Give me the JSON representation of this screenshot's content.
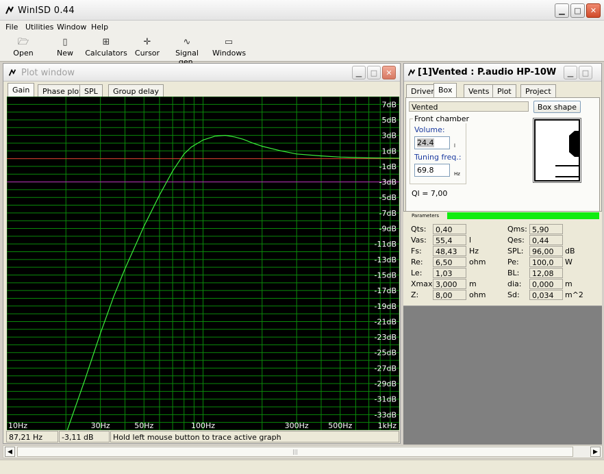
{
  "app": {
    "title": "WinISD 0.44"
  },
  "menu": [
    "File",
    "Utilities",
    "Window",
    "Help"
  ],
  "toolbar": [
    "Open",
    "New",
    "Calculators",
    "Cursor",
    "Signal gen.",
    "Windows"
  ],
  "plot_window": {
    "title": "Plot window",
    "tabs": [
      "Gain",
      "Phase plot",
      "SPL",
      "Group delay"
    ],
    "active_tab": "Gain",
    "status": {
      "freq": "87,21 Hz",
      "gain": "-3,11 dB",
      "hint": "Hold left mouse button to trace active graph"
    }
  },
  "chart_data": {
    "type": "line",
    "x_scale": "log",
    "xlim": [
      10,
      1000
    ],
    "ylim": [
      -35,
      8
    ],
    "x_ticks": [
      {
        "value": 10,
        "label": "10Hz"
      },
      {
        "value": 30,
        "label": "30Hz"
      },
      {
        "value": 50,
        "label": "50Hz"
      },
      {
        "value": 100,
        "label": "100Hz"
      },
      {
        "value": 300,
        "label": "300Hz"
      },
      {
        "value": 500,
        "label": "500Hz"
      },
      {
        "value": 1000,
        "label": "1kHz"
      }
    ],
    "y_ticks": [
      {
        "value": 7,
        "label": "7dB"
      },
      {
        "value": 5,
        "label": "5dB"
      },
      {
        "value": 3,
        "label": "3dB"
      },
      {
        "value": 1,
        "label": "1dB"
      },
      {
        "value": -1,
        "label": "-1dB"
      },
      {
        "value": -3,
        "label": "-3dB"
      },
      {
        "value": -5,
        "label": "-5dB"
      },
      {
        "value": -7,
        "label": "-7dB"
      },
      {
        "value": -9,
        "label": "-9dB"
      },
      {
        "value": -11,
        "label": "-11dB"
      },
      {
        "value": -13,
        "label": "-13dB"
      },
      {
        "value": -15,
        "label": "-15dB"
      },
      {
        "value": -17,
        "label": "-17dB"
      },
      {
        "value": -19,
        "label": "-19dB"
      },
      {
        "value": -21,
        "label": "-21dB"
      },
      {
        "value": -23,
        "label": "-23dB"
      },
      {
        "value": -25,
        "label": "-25dB"
      },
      {
        "value": -27,
        "label": "-27dB"
      },
      {
        "value": -29,
        "label": "-29dB"
      },
      {
        "value": -31,
        "label": "-31dB"
      },
      {
        "value": -33,
        "label": "-33dB"
      }
    ],
    "reference_lines": [
      {
        "y": 0,
        "color": "#e03030"
      },
      {
        "y": -3,
        "color": "#c020c0"
      }
    ],
    "series": [
      {
        "color": "#3cf03c",
        "x": [
          20,
          25,
          30,
          35,
          40,
          50,
          60,
          70,
          80,
          87.21,
          100,
          115,
          130,
          145,
          160,
          180,
          200,
          250,
          300,
          400,
          500,
          700,
          1000
        ],
        "y": [
          -35.5,
          -28.5,
          -22.5,
          -17.8,
          -14.2,
          -8.7,
          -4.7,
          -1.6,
          0.6,
          1.5,
          2.4,
          2.9,
          3.0,
          2.8,
          2.5,
          2.0,
          1.6,
          1.0,
          0.6,
          0.35,
          0.2,
          0.1,
          0.05
        ]
      }
    ],
    "grid": true
  },
  "box_window": {
    "title": "[1]Vented : P.audio HP-10W",
    "tabs": [
      "Driver",
      "Box",
      "Vents",
      "Plot",
      "Project"
    ],
    "active_tab": "Box",
    "box_type": "Vented",
    "box_shape_button": "Box shape",
    "front_chamber_label": "Front chamber",
    "volume_label": "Volume:",
    "volume_value": "24.4",
    "volume_unit": "l",
    "tuning_label": "Tuning freq.:",
    "tuning_value": "69.8",
    "tuning_unit": "Hz",
    "ql": "Ql = 7,00",
    "parameters_label": "Parameters",
    "params_left": [
      {
        "name": "Qts:",
        "value": "0,40",
        "unit": ""
      },
      {
        "name": "Vas:",
        "value": "55,4",
        "unit": "l"
      },
      {
        "name": "Fs:",
        "value": "48,43",
        "unit": "Hz"
      },
      {
        "name": "Re:",
        "value": "6,50",
        "unit": "ohm"
      },
      {
        "name": "Le:",
        "value": "1,03",
        "unit": ""
      },
      {
        "name": "Xmax:",
        "value": "3,000",
        "unit": "m"
      },
      {
        "name": "Z:",
        "value": "8,00",
        "unit": "ohm"
      }
    ],
    "params_right": [
      {
        "name": "Qms:",
        "value": "5,90",
        "unit": ""
      },
      {
        "name": "Qes:",
        "value": "0,44",
        "unit": ""
      },
      {
        "name": "SPL:",
        "value": "96,00",
        "unit": "dB"
      },
      {
        "name": "Pe:",
        "value": "100,0",
        "unit": "W"
      },
      {
        "name": "BL:",
        "value": "12,08",
        "unit": ""
      },
      {
        "name": "dia:",
        "value": "0,000",
        "unit": "m"
      },
      {
        "name": "Sd:",
        "value": "0,034",
        "unit": "m^2"
      }
    ]
  }
}
